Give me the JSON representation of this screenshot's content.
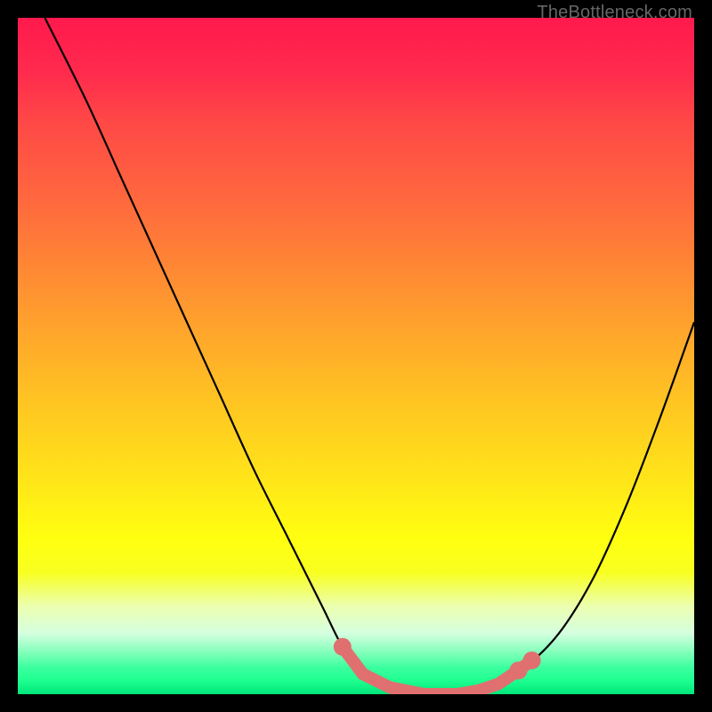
{
  "attribution": "TheBottleneck.com",
  "colors": {
    "background": "#000000",
    "gradient_top": "#ff1a4d",
    "gradient_mid": "#ffff10",
    "gradient_bottom": "#00e57a",
    "curve": "#000000",
    "hotspot": "#e07070"
  },
  "chart_data": {
    "type": "line",
    "title": "",
    "xlabel": "",
    "ylabel": "",
    "xlim": [
      0,
      100
    ],
    "ylim": [
      0,
      100
    ],
    "series": [
      {
        "name": "bottleneck-curve",
        "x": [
          4,
          10,
          15,
          20,
          25,
          30,
          35,
          40,
          45,
          48,
          51,
          55,
          60,
          65,
          70,
          75,
          80,
          85,
          90,
          95,
          100
        ],
        "y": [
          100,
          88,
          77,
          66,
          55,
          44,
          33,
          23,
          13,
          7,
          3,
          1,
          0,
          0,
          1,
          4,
          9,
          17,
          28,
          41,
          55
        ]
      }
    ],
    "hotspots": [
      {
        "x": 48,
        "y": 7,
        "size": "large"
      },
      {
        "x": 51,
        "y": 3,
        "size": "small"
      },
      {
        "x": 55,
        "y": 1,
        "size": "small"
      },
      {
        "x": 60,
        "y": 0,
        "size": "small"
      },
      {
        "x": 65,
        "y": 0,
        "size": "small"
      },
      {
        "x": 68,
        "y": 0.5,
        "size": "small"
      },
      {
        "x": 71,
        "y": 1.5,
        "size": "small"
      },
      {
        "x": 74,
        "y": 3.5,
        "size": "large"
      },
      {
        "x": 76,
        "y": 5,
        "size": "large"
      }
    ],
    "annotations": []
  }
}
